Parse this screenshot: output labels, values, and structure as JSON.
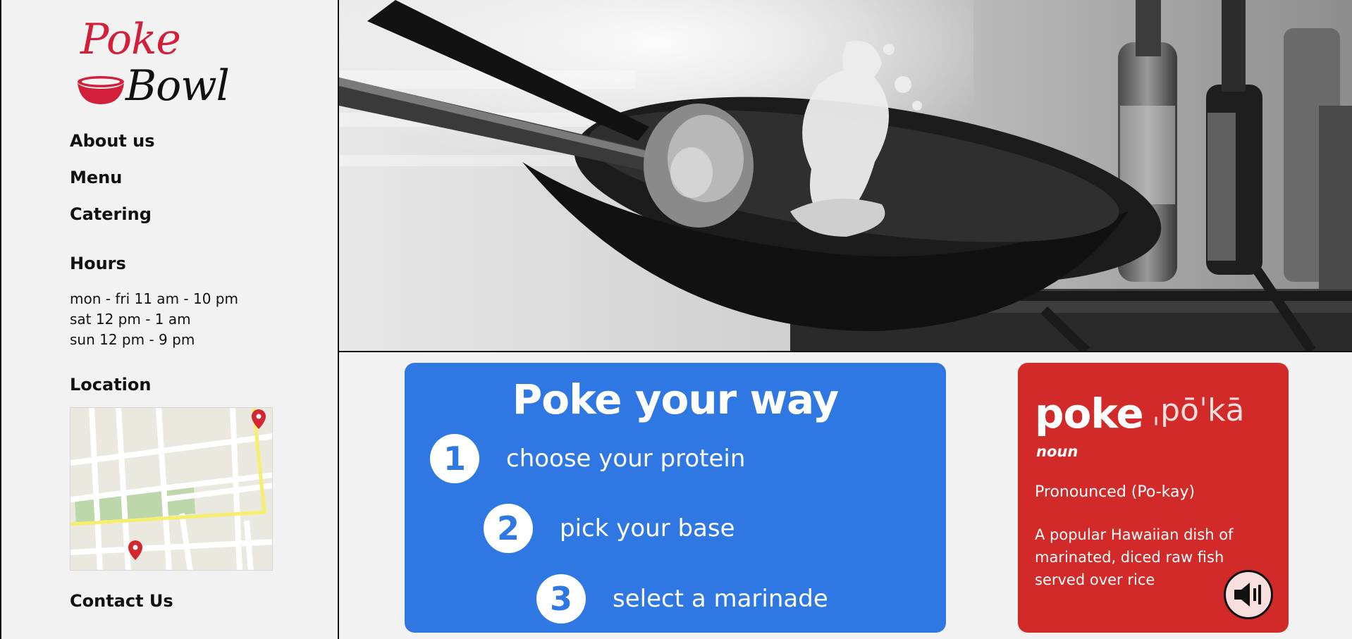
{
  "logo": {
    "line1": "Poke",
    "line2": "Bowl"
  },
  "nav": [
    "About us",
    "Menu",
    "Catering"
  ],
  "hours": {
    "title": "Hours",
    "lines": [
      "mon - fri 11 am - 10 pm",
      "sat 12 pm - 1 am",
      "sun 12 pm - 9 pm"
    ]
  },
  "location": {
    "title": "Location"
  },
  "contact": {
    "title": "Contact Us"
  },
  "steps": {
    "title": "Poke your way",
    "items": [
      {
        "num": "1",
        "text": "choose your protein"
      },
      {
        "num": "2",
        "text": "pick your base"
      },
      {
        "num": "3",
        "text": "select a marinade"
      }
    ]
  },
  "definition": {
    "word": "poke",
    "phonetic": "ˌpōˈkā",
    "pos": "noun",
    "pronounced": "Pronounced (Po-kay)",
    "meaning": "A popular Hawaiian dish of marinated, diced raw fish served over rice"
  },
  "colors": {
    "brand_red": "#d3203a",
    "steps_blue": "#2f78e3",
    "definition_red": "#d12a29"
  },
  "icons": {
    "bowl": "bowl-icon",
    "map_pin": "map-pin-icon",
    "speaker": "speaker-icon"
  }
}
